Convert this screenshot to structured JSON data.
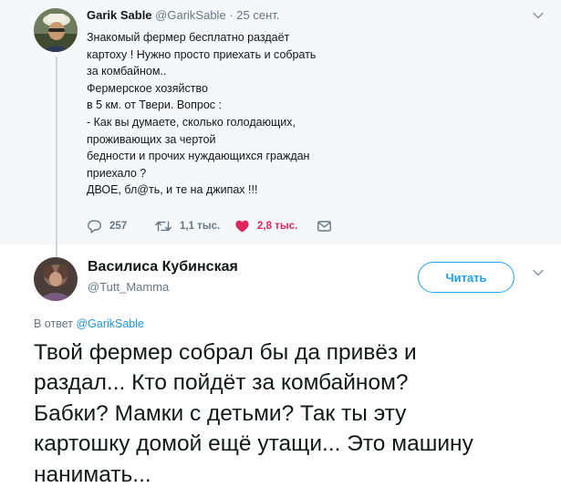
{
  "parent_tweet": {
    "author_name": "Garik Sable",
    "author_handle": "@GarikSable",
    "separator": "·",
    "date": "25 сент.",
    "text_lines": [
      "Знакомый фермер бесплатно раздаёт",
      "картоху ! Нужно просто приехать и собрать",
      "за комбайном..",
      "Фермерское хозяйство",
      "в 5 км. от Твери. Вопрос :",
      "- Как вы думаете, сколько голодающих,",
      "проживающих за чертой",
      "бедности и прочих нуждающихся граждан",
      "приехало ?",
      "ДВОЕ, бл@ть, и те на джипах !!!"
    ],
    "replies": "257",
    "retweets": "1,1 тыс.",
    "likes": "2,8 тыс.",
    "like_color": "#e0245e"
  },
  "reply_tweet": {
    "author_name": "Василиса Кубинская",
    "author_handle": "@Tutt_Mamma",
    "follow_label": "Читать",
    "reply_to_prefix": "В ответ",
    "reply_to_handle": "@GarikSable",
    "text_lines": [
      "Твой фермер собрал бы да привёз и",
      "раздал... Кто пойдёт за комбайном?",
      "Бабки? Мамки с детьми? Так ты эту",
      "картошку домой ещё утащи... Это машину",
      "нанимать..."
    ]
  },
  "colors": {
    "accent": "#1da1f2",
    "link": "#1b95e0",
    "muted": "#657786",
    "parent_background": "#f5f8fa"
  }
}
